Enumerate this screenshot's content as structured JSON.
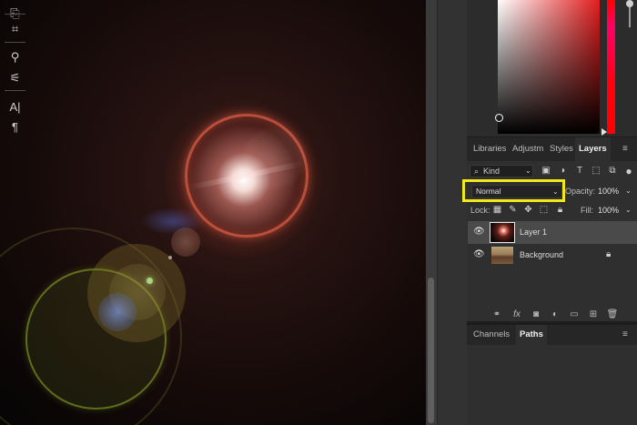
{
  "colors": {
    "highlight": "#f0ea1c",
    "panel_bg": "#2f2f2f",
    "selected_row": "#4a4a4a",
    "foreground_hue": "#e11d1d"
  },
  "tools": [
    {
      "icon": "clone-stamp-icon",
      "glyph": "⎘"
    },
    {
      "icon": "content-aware-icon",
      "glyph": "⌗"
    },
    {
      "icon": "puppet-warp-icon",
      "glyph": "⚲"
    },
    {
      "icon": "adjust-sliders-icon",
      "glyph": "⚟"
    },
    {
      "icon": "type-cursor-icon",
      "glyph": "A|"
    },
    {
      "icon": "paragraph-icon",
      "glyph": "¶"
    }
  ],
  "layers_panel": {
    "tabs": [
      "Libraries",
      "Adjustm",
      "Styles",
      "Layers"
    ],
    "active_tab": "Layers",
    "menu_glyph": "≡",
    "filter": {
      "icon": "search-icon",
      "icon_glyph": "⌕",
      "label": "Kind",
      "chevron": "⌄"
    },
    "filter_icons": [
      {
        "name": "pixel-filter-icon",
        "glyph": "▣"
      },
      {
        "name": "adjustment-filter-icon",
        "glyph": "◑"
      },
      {
        "name": "type-filter-icon",
        "glyph": "T"
      },
      {
        "name": "shape-filter-icon",
        "glyph": "⬚"
      },
      {
        "name": "smart-object-filter-icon",
        "glyph": "⧉"
      }
    ],
    "blend_mode": "Normal",
    "blend_chevron": "⌄",
    "opacity_label": "Opacity:",
    "opacity_value": "100%",
    "lock_label": "Lock:",
    "lock_icons": [
      {
        "name": "lock-transparent-icon",
        "glyph": "▦"
      },
      {
        "name": "lock-pixels-icon",
        "glyph": "✎"
      },
      {
        "name": "lock-position-icon",
        "glyph": "✥"
      },
      {
        "name": "lock-artboard-icon",
        "glyph": "⬚"
      },
      {
        "name": "lock-all-icon",
        "glyph": "🔒︎"
      }
    ],
    "fill_label": "Fill:",
    "fill_value": "100%",
    "layers": [
      {
        "name": "Layer 1",
        "visible": true,
        "selected": true,
        "locked": false
      },
      {
        "name": "Background",
        "visible": true,
        "selected": false,
        "locked": true
      }
    ],
    "eye_glyph": "👁︎",
    "lock_glyph": "🔒︎",
    "bottom_icons": [
      {
        "name": "link-layers-icon",
        "glyph": "⚭"
      },
      {
        "name": "fx-icon",
        "glyph": "fx"
      },
      {
        "name": "add-mask-icon",
        "glyph": "◙"
      },
      {
        "name": "adjustment-layer-icon",
        "glyph": "◐"
      },
      {
        "name": "new-group-icon",
        "glyph": "▭"
      },
      {
        "name": "new-layer-icon",
        "glyph": "⊞"
      },
      {
        "name": "delete-layer-icon",
        "glyph": "🗑︎"
      }
    ]
  },
  "channels_panel": {
    "tabs": [
      "Channels",
      "Paths"
    ],
    "active_tab": "Paths",
    "menu_glyph": "≡"
  }
}
